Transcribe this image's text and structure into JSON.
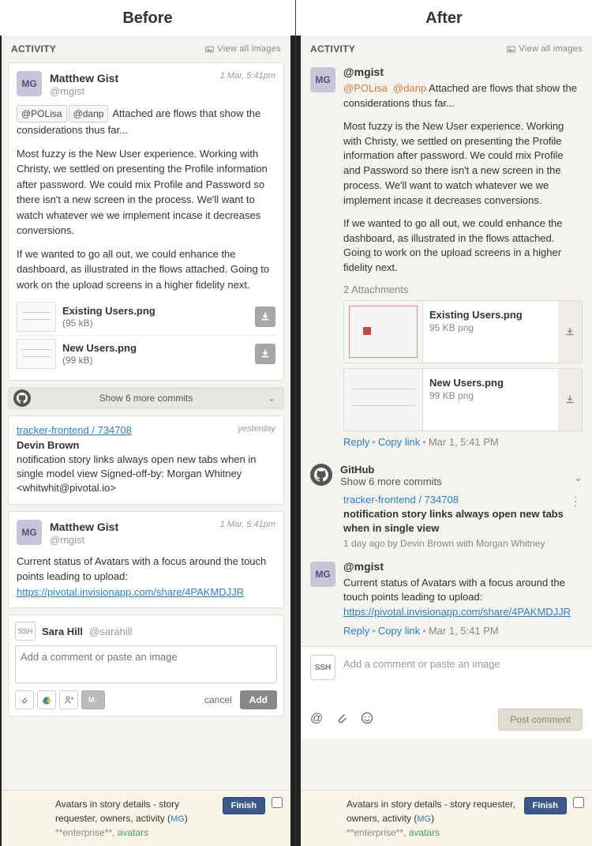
{
  "headings": {
    "before": "Before",
    "after": "After"
  },
  "activity_label": "ACTIVITY",
  "view_all_images": "View all images",
  "before": {
    "post1": {
      "avatar": "MG",
      "name": "Matthew Gist",
      "handle": "@mgist",
      "timestamp": "1 Mar, 5:41pm",
      "mentions": [
        "@POLisa",
        "@danp"
      ],
      "line1_rest": " Attached are flows that show the considerations thus far...",
      "para2": "Most fuzzy is the New User experience. Working with Christy, we settled on presenting the Profile information after password. We could mix Profile and Password so there isn't a new screen in the process. We'll want to watch whatever we we implement incase it decreases conversions.",
      "para3": "If we wanted to go all out, we could enhance the dashboard, as illustrated in the flows attached. Going to work on the upload screens in a higher fidelity next.",
      "attachments": [
        {
          "name": "Existing Users.png",
          "size": "(95 kB)"
        },
        {
          "name": "New Users.png",
          "size": "(99 kB)"
        }
      ]
    },
    "commits_bar": "Show 6 more commits",
    "commit": {
      "link": "tracker-frontend / 734708",
      "when": "yesterday",
      "author": "Devin Brown",
      "msg": "notification story links always open new tabs when in single model view Signed-off-by: Morgan Whitney <whitwhit@pivotal.io>"
    },
    "post2": {
      "avatar": "MG",
      "name": "Matthew Gist",
      "handle": "@mgist",
      "timestamp": "1 Mar, 5:41pm",
      "body": "Current status of Avatars with a focus around the touch points leading to upload:",
      "url": "https://pivotal.invisionapp.com/share/4PAKMDJJR"
    },
    "comment": {
      "ssh": "SSH",
      "name": "Sara Hill",
      "handle": "@sarahill",
      "placeholder": "Add a comment or paste an image",
      "cancel": "cancel",
      "add": "Add"
    },
    "story": {
      "text": "Avatars in story details - story requester, owners, activity (",
      "pill": "MG",
      "close": ")",
      "ent": "**enterprise**",
      "sep": ", ",
      "avatars": "avatars",
      "finish": "Finish"
    }
  },
  "after": {
    "post1": {
      "avatar": "MG",
      "handle": "@mgist",
      "mentions": [
        "@POLisa",
        "@danp"
      ],
      "line1_rest": "  Attached are flows that show the considerations thus far...",
      "para2": "Most fuzzy is the New User experience. Working with Christy, we settled on presenting the Profile information after password. We could mix Profile and Password so there isn't a new screen in the process. We'll want to watch whatever we we implement incase it decreases conversions.",
      "para3": "If we wanted to go all out, we could enhance the dashboard, as illustrated in the flows attached. Going to work on the upload screens in a higher fidelity next.",
      "att_count": "2 Attachments",
      "attachments": [
        {
          "name": "Existing Users.png",
          "size": "95 KB png"
        },
        {
          "name": "New Users.png",
          "size": "99 KB png"
        }
      ],
      "reply": "Reply",
      "copy": "Copy link",
      "ts": "Mar 1, 5:41 PM"
    },
    "github": {
      "label": "GitHub",
      "more": "Show 6 more commits"
    },
    "commit": {
      "link": "tracker-frontend / 734708",
      "msg": "notification story links always open new tabs when in single view",
      "by": "1 day ago by Devin Brown with Morgan Whitney"
    },
    "post2": {
      "avatar": "MG",
      "handle": "@mgist",
      "body": "Current status of Avatars with a focus around the touch points leading to upload:",
      "url": "https://pivotal.invisionapp.com/share/4PAKMDJJR",
      "reply": "Reply",
      "copy": "Copy link",
      "ts": "Mar 1, 5:41 PM"
    },
    "comment": {
      "ssh": "SSH",
      "placeholder": "Add a comment or paste an image",
      "post": "Post comment"
    },
    "story": {
      "text": "Avatars in story details - story requester, owners, activity (",
      "pill": "MG",
      "close": ")",
      "ent": "**enterprise**",
      "sep": ", ",
      "avatars": "avatars",
      "finish": "Finish"
    }
  }
}
